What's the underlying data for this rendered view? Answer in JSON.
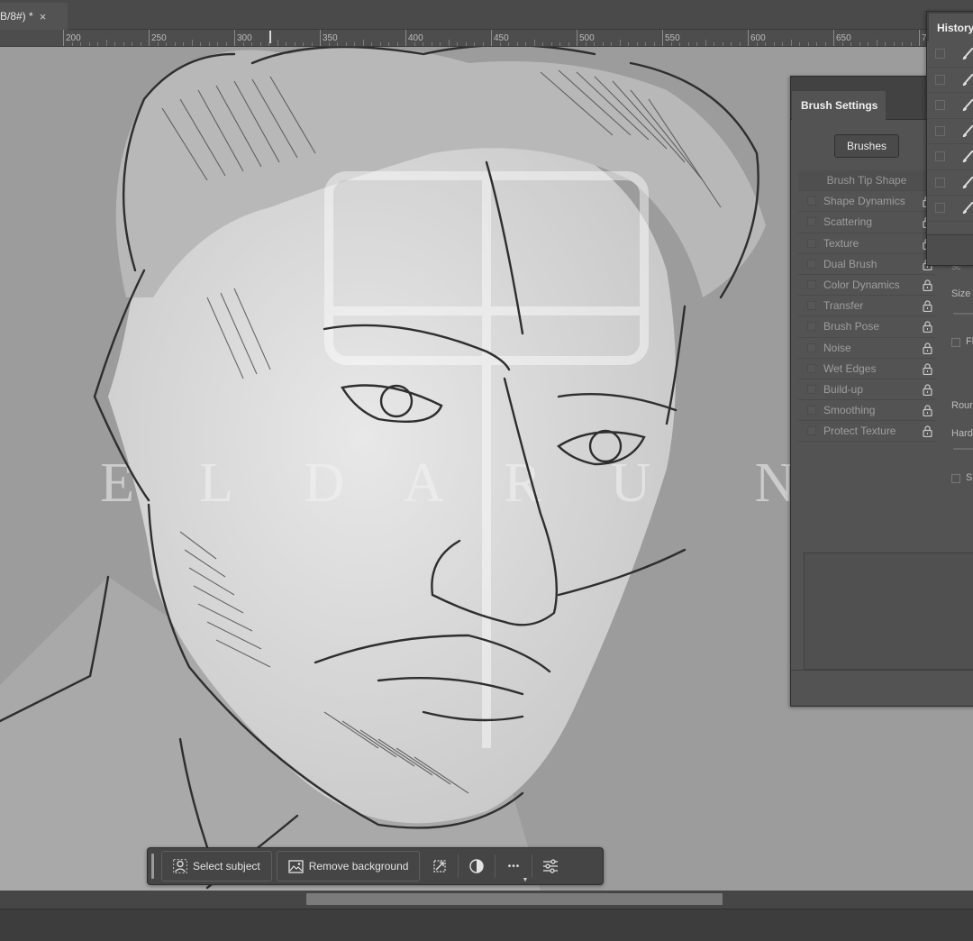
{
  "document_tab": {
    "title": "B/8#) *",
    "close_glyph": "×"
  },
  "ruler": {
    "labels": [
      "200",
      "250",
      "300",
      "350",
      "400",
      "450",
      "500",
      "550",
      "600",
      "650",
      "7"
    ]
  },
  "canvas": {
    "artwork": "pencil-sketch-portrait",
    "watermark_text": "E L D A R U N E"
  },
  "brush_settings": {
    "tab_title": "Brush Settings",
    "brushes_button": "Brushes",
    "options": [
      "Brush Tip Shape",
      "Shape Dynamics",
      "Scattering",
      "Texture",
      "Dual Brush",
      "Color Dynamics",
      "Transfer",
      "Brush Pose",
      "Noise",
      "Wet Edges",
      "Build-up",
      "Smoothing",
      "Protect Texture"
    ],
    "right_labels": {
      "size": "Size",
      "flip": "Fl",
      "round": "Rour",
      "hard": "Hard",
      "spacing": "S",
      "top": "Sc"
    }
  },
  "history": {
    "tab_title": "History",
    "row_count": 7,
    "row_icon": "brush-icon"
  },
  "taskbar": {
    "select_subject": "Select subject",
    "remove_background": "Remove background",
    "icons": [
      "transform-icon",
      "adjustment-icon",
      "more-icon",
      "settings-sliders-icon"
    ],
    "more_glyph": "•••"
  },
  "colors": {
    "ui_panel": "#535353",
    "ui_dark": "#424242",
    "canvas_bg": "#9c9c9c",
    "sketch_line": "#2e2e2e"
  }
}
